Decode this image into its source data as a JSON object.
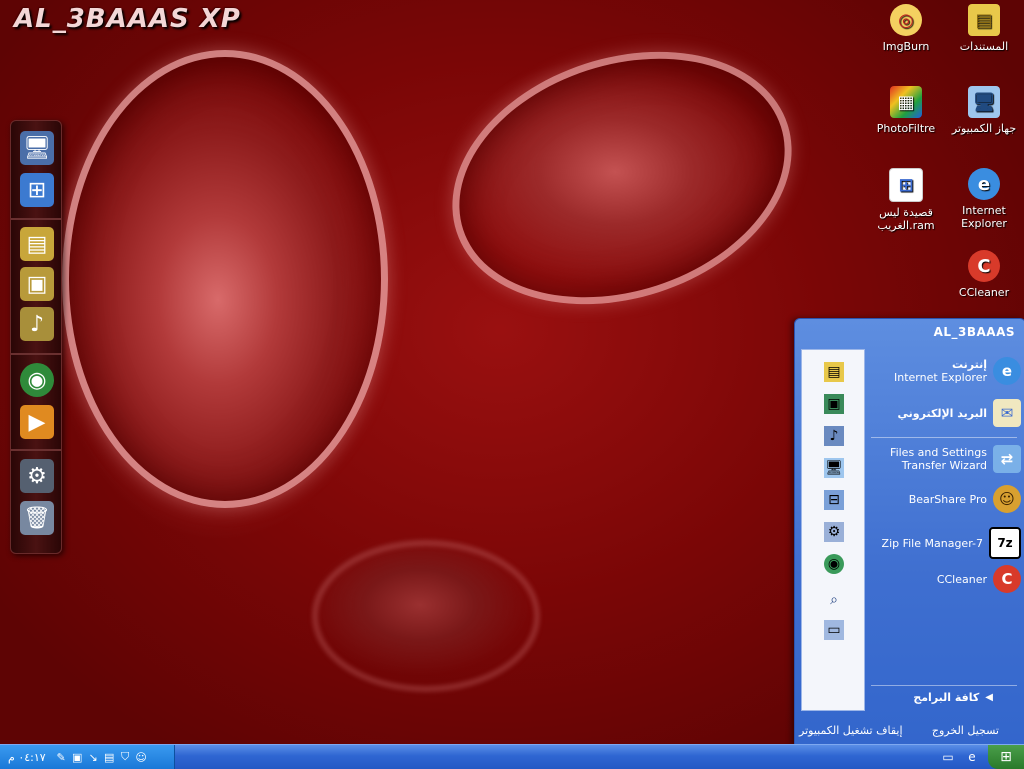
{
  "desktop": {
    "brand": "AL_3BAAAS XP",
    "icons": [
      {
        "label": "ImgBurn",
        "icon": "disc-burn-icon",
        "color": "#f0c040"
      },
      {
        "label": "المستندات",
        "icon": "folder-documents-icon",
        "color": "#e8c84a"
      },
      {
        "label": "PhotoFiltre",
        "icon": "photofiltre-icon",
        "color": "#e05020"
      },
      {
        "label": "جهاز الكمبيوتر",
        "icon": "my-computer-icon",
        "color": "#9ec6ee"
      },
      {
        "label": "قصيدة ليس الغريب.ram",
        "icon": "media-file-icon",
        "color": "#ffffff"
      },
      {
        "label": "Internet Explorer",
        "icon": "internet-explorer-icon",
        "color": "#3a8de0"
      },
      {
        "label": "CCleaner",
        "icon": "ccleaner-icon",
        "color": "#d83a2a"
      }
    ]
  },
  "dock": {
    "items": [
      "my-computer-icon",
      "windows-icon",
      "folder-icon",
      "folder-pictures-icon",
      "folder-music-icon",
      "globe-icon",
      "media-player-icon",
      "gear-icon",
      "recycle-bin-icon"
    ]
  },
  "start_menu": {
    "user": "AL_3BAAAS",
    "pinned": [
      {
        "title": "إنترنت",
        "subtitle": "Internet Explorer",
        "icon": "internet-explorer-icon"
      },
      {
        "title": "البريد الإلكتروني",
        "subtitle": "",
        "icon": "email-icon"
      }
    ],
    "recent": [
      {
        "title": "Files and Settings Transfer Wizard",
        "icon": "transfer-wizard-icon"
      },
      {
        "title": "BearShare Pro",
        "icon": "bearshare-icon"
      },
      {
        "title": "Zip File Manager-7",
        "icon": "7zip-icon"
      },
      {
        "title": "CCleaner",
        "icon": "ccleaner-icon"
      }
    ],
    "all_programs": "كافة البرامج",
    "logoff": "تسجيل الخروج",
    "shutdown": "إيقاف تشغيل الكمبيوتر"
  },
  "taskbar": {
    "clock": "٠٤:١٧ م"
  }
}
